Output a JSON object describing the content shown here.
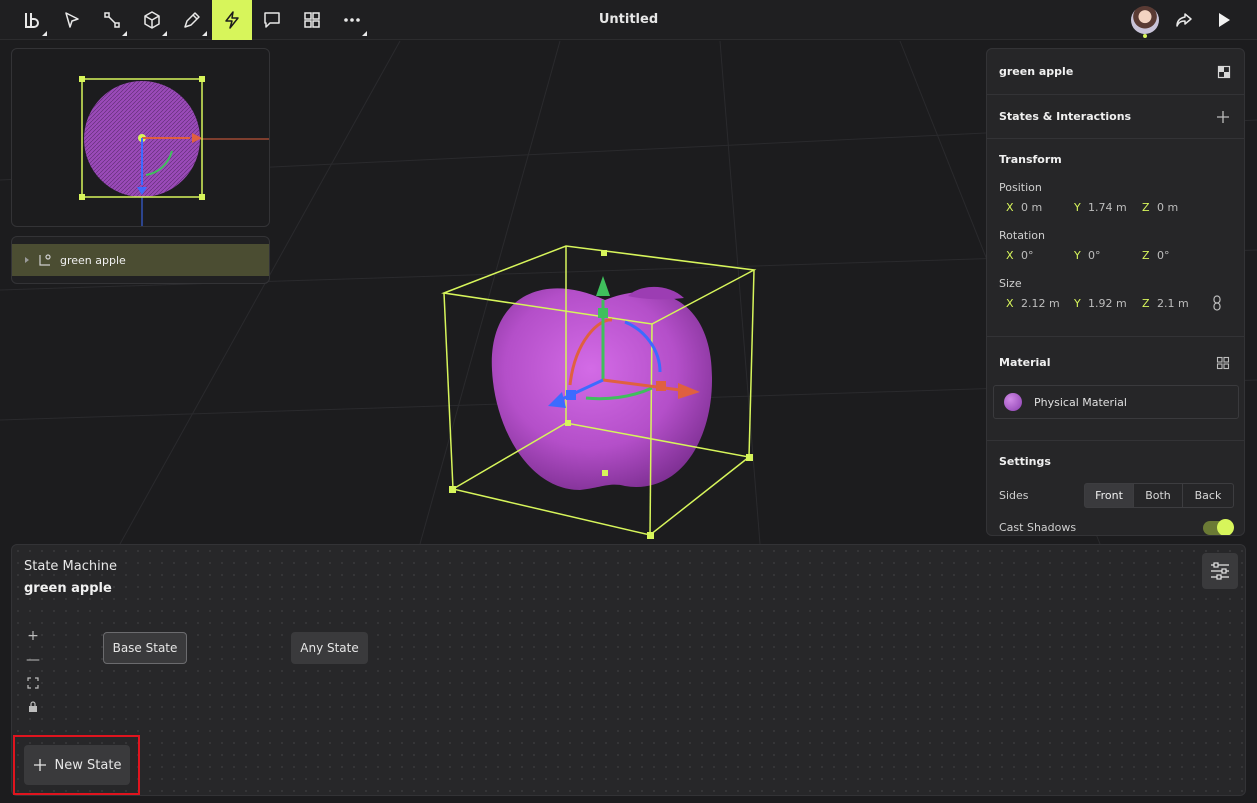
{
  "app": {
    "title": "Untitled"
  },
  "toolbar": {
    "tools": [
      {
        "icon": "logo-menu-icon"
      },
      {
        "icon": "select-arrow-icon"
      },
      {
        "icon": "frame-icon"
      },
      {
        "icon": "cube-icon"
      },
      {
        "icon": "pen-icon"
      },
      {
        "icon": "lightning-icon",
        "active": true
      },
      {
        "icon": "comment-icon"
      },
      {
        "icon": "grid-icon"
      },
      {
        "icon": "more-icon"
      }
    ],
    "right": [
      "avatar",
      "share-icon",
      "play-icon"
    ]
  },
  "colors": {
    "accent": "#d7f55b",
    "object": "#b44fc9",
    "highlight_box": "#e0141e"
  },
  "outline": {
    "item_label": "green apple"
  },
  "properties": {
    "object_name": "green apple",
    "states_interactions": "States & Interactions",
    "transform": {
      "heading": "Transform",
      "position": {
        "label": "Position",
        "x_axis": "X",
        "x": "0 m",
        "y_axis": "Y",
        "y": "1.74 m",
        "z_axis": "Z",
        "z": "0 m"
      },
      "rotation": {
        "label": "Rotation",
        "x_axis": "X",
        "x": "0°",
        "y_axis": "Y",
        "y": "0°",
        "z_axis": "Z",
        "z": "0°"
      },
      "size": {
        "label": "Size",
        "x_axis": "X",
        "x": "2.12 m",
        "y_axis": "Y",
        "y": "1.92 m",
        "z_axis": "Z",
        "z": "2.1 m"
      }
    },
    "material": {
      "heading": "Material",
      "name": "Physical Material"
    },
    "settings": {
      "heading": "Settings",
      "sides_label": "Sides",
      "sides": [
        "Front",
        "Both",
        "Back"
      ],
      "sides_selected": "Front",
      "cast_shadows_label": "Cast Shadows",
      "cast_shadows": true
    }
  },
  "state_machine": {
    "title": "State Machine",
    "object": "green apple",
    "base_state": "Base State",
    "any_state": "Any State",
    "new_state": "New State"
  }
}
